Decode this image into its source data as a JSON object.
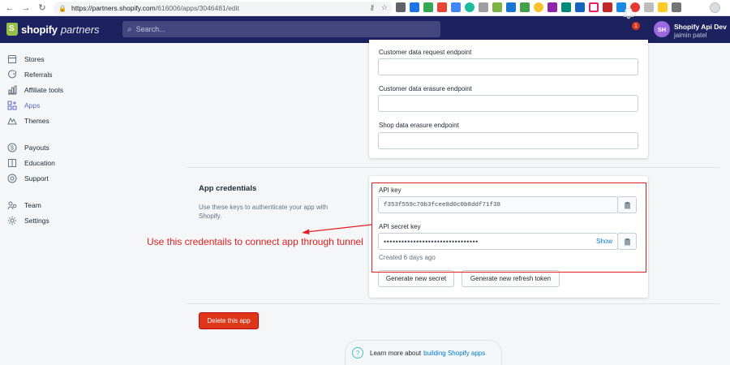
{
  "browser": {
    "url_host": "https://partners.shopify.com",
    "url_path": "/616006/apps/3046481/edit"
  },
  "topbar": {
    "logo_primary": "shopify",
    "logo_secondary": "partners",
    "search_placeholder": "Search...",
    "notifications_count": "1",
    "avatar_initials": "SH",
    "user_name": "Shopify Api Dev",
    "user_sub": "jaimin patel"
  },
  "sidebar": {
    "items": [
      {
        "label": "Stores",
        "icon": "stores-icon"
      },
      {
        "label": "Referrals",
        "icon": "referrals-icon"
      },
      {
        "label": "Affiliate tools",
        "icon": "affiliate-tools-icon"
      },
      {
        "label": "Apps",
        "icon": "apps-icon"
      },
      {
        "label": "Themes",
        "icon": "themes-icon"
      },
      {
        "label": "Payouts",
        "icon": "payouts-icon"
      },
      {
        "label": "Education",
        "icon": "education-icon"
      },
      {
        "label": "Support",
        "icon": "support-icon"
      },
      {
        "label": "Team",
        "icon": "team-icon"
      },
      {
        "label": "Settings",
        "icon": "settings-icon"
      }
    ]
  },
  "webhooks": {
    "customer_data_request_label": "Customer data request endpoint",
    "customer_data_request_value": "",
    "customer_data_erasure_label": "Customer data erasure endpoint",
    "customer_data_erasure_value": "",
    "shop_data_erasure_label": "Shop data erasure endpoint",
    "shop_data_erasure_value": ""
  },
  "credentials": {
    "title": "App credentials",
    "description": "Use these keys to authenticate your app with Shopify.",
    "api_key_label": "API key",
    "api_key_value": "f353f559c70b3fcee8d0c0b8ddf71f38",
    "api_secret_label": "API secret key",
    "api_secret_value": "••••••••••••••••••••••••••••••••",
    "show_label": "Show",
    "created_text": "Created 6 days ago",
    "generate_secret_label": "Generate new secret",
    "generate_token_label": "Generate new refresh token"
  },
  "danger": {
    "delete_label": "Delete this app"
  },
  "footer": {
    "prefix": "Learn more about",
    "link": "building Shopify apps"
  },
  "annotation": {
    "text": "Use this credentails to connect app through tunnel",
    "color": "#e02020"
  },
  "colors": {
    "topbar": "#1c2260",
    "accent": "#5c6ac4",
    "danger": "#de3618",
    "link": "#007ace"
  }
}
